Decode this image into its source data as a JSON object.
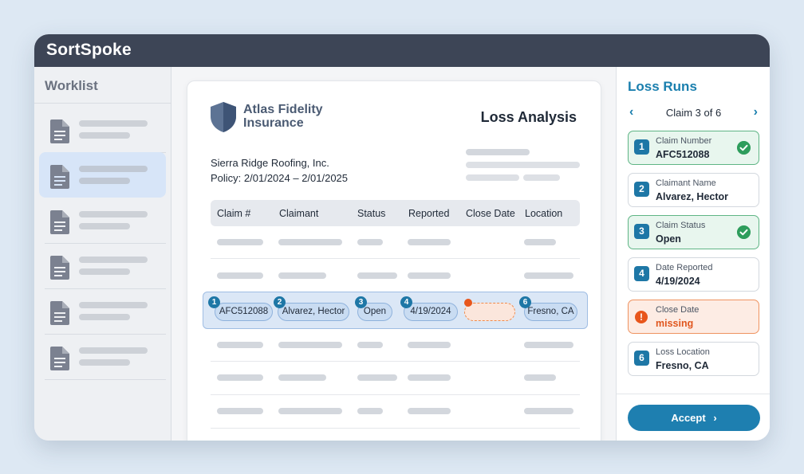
{
  "app": {
    "title": "SortSpoke"
  },
  "worklist": {
    "title": "Worklist",
    "item_count": 6,
    "selected_index": 1
  },
  "document": {
    "company_name_line1": "Atlas Fidelity",
    "company_name_line2": "Insurance",
    "title": "Loss Analysis",
    "insured": "Sierra Ridge Roofing, Inc.",
    "policy": "Policy: 2/01/2024 – 2/01/2025",
    "columns": [
      "Claim #",
      "Claimant",
      "Status",
      "Reported",
      "Close Date",
      "Location"
    ],
    "highlighted_row": {
      "claim_number": "AFC512088",
      "claimant": "Alvarez, Hector",
      "status": "Open",
      "reported": "4/19/2024",
      "close_date": "",
      "location": "Fresno, CA",
      "badges": [
        "1",
        "2",
        "3",
        "4",
        "6"
      ]
    }
  },
  "panel": {
    "title": "Loss Runs",
    "nav_label": "Claim 3 of 6",
    "fields": [
      {
        "num": "1",
        "label": "Claim Number",
        "value": "AFC512088",
        "state": "ok"
      },
      {
        "num": "2",
        "label": "Claimant Name",
        "value": "Alvarez, Hector",
        "state": "normal"
      },
      {
        "num": "3",
        "label": "Claim Status",
        "value": "Open",
        "state": "ok"
      },
      {
        "num": "4",
        "label": "Date Reported",
        "value": "4/19/2024",
        "state": "normal"
      },
      {
        "num": "!",
        "label": "Close Date",
        "value": "missing",
        "state": "missing"
      },
      {
        "num": "6",
        "label": "Loss Location",
        "value": "Fresno, CA",
        "state": "normal"
      }
    ],
    "accept_label": "Accept"
  },
  "colors": {
    "titlebar": "#3d4556",
    "accent": "#1e7fb0",
    "ok_green": "#2e9d5c",
    "missing_orange": "#e8561c",
    "selected_item": "#d7e5f8"
  },
  "icons": [
    "document-icon",
    "shield-logo-icon",
    "chevron-left-icon",
    "chevron-right-icon",
    "check-circle-icon",
    "alert-circle-icon"
  ]
}
